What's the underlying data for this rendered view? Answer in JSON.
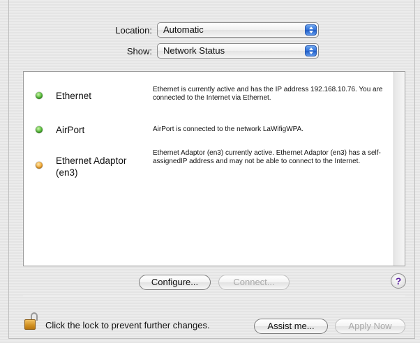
{
  "location": {
    "label": "Location:",
    "value": "Automatic"
  },
  "show": {
    "label": "Show:",
    "value": "Network Status"
  },
  "services": [
    {
      "name": "Ethernet",
      "status": "green",
      "description": "Ethernet is currently active and has the IP address 192.168.10.76. You are connected to the Internet via Ethernet."
    },
    {
      "name": "AirPort",
      "status": "green",
      "description": "AirPort is connected to the network LaWifigWPA."
    },
    {
      "name": "Ethernet Adaptor (en3)",
      "status": "yellow",
      "description": "Ethernet Adaptor (en3) currently active. Ethernet Adaptor (en3) has a self-assignedIP address and may not be able to connect to the Internet."
    }
  ],
  "buttons": {
    "configure": "Configure...",
    "connect": "Connect...",
    "help": "?",
    "assist": "Assist me...",
    "apply": "Apply Now"
  },
  "lock_text": "Click the lock to prevent further changes.",
  "colors": {
    "status_green": "#48b42c",
    "status_yellow": "#f2a32a"
  }
}
